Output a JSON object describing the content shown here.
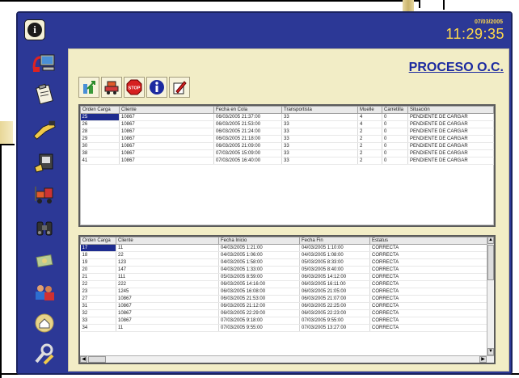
{
  "header": {
    "info_label": "i",
    "date": "07/03/2005",
    "clock": "11:29:35"
  },
  "page": {
    "title": "PROCESO O.C."
  },
  "toolbar": {
    "icons": [
      "green-arrow-icon",
      "truck-icon",
      "stop-icon",
      "info-icon",
      "edit-icon"
    ]
  },
  "sidebar": {
    "icons": [
      "computer-icon",
      "clipboard-icon",
      "scanner-icon",
      "printer-icon",
      "forklift-icon",
      "binoculars-icon",
      "money-icon",
      "users-icon",
      "home-icon",
      "tools-icon"
    ]
  },
  "top_grid": {
    "columns": [
      "Orden Carga",
      "Cliente",
      "Fecha en Cola",
      "Transportista",
      "Muelle",
      "Carretilla",
      "Situación"
    ],
    "rows": [
      [
        "25",
        "10867",
        "06/03/2005 21:37:00",
        "33",
        "4",
        "0",
        "PENDIENTE DE CARGAR"
      ],
      [
        "26",
        "10867",
        "06/03/2005 21:53:00",
        "33",
        "4",
        "0",
        "PENDIENTE DE CARGAR"
      ],
      [
        "28",
        "10867",
        "06/03/2005 21:24:00",
        "33",
        "2",
        "0",
        "PENDIENTE DE CARGAR"
      ],
      [
        "29",
        "10867",
        "06/03/2005 21:18:00",
        "33",
        "2",
        "0",
        "PENDIENTE DE CARGAR"
      ],
      [
        "30",
        "10867",
        "06/03/2005 21:09:00",
        "33",
        "2",
        "0",
        "PENDIENTE DE CARGAR"
      ],
      [
        "38",
        "10867",
        "07/03/2005 15:09:00",
        "33",
        "2",
        "0",
        "PENDIENTE DE CARGAR"
      ],
      [
        "41",
        "10867",
        "07/03/2005 16:40:00",
        "33",
        "2",
        "0",
        "PENDIENTE DE CARGAR"
      ]
    ]
  },
  "bottom_grid": {
    "columns": [
      "Orden Carga",
      "Cliente",
      "Fecha Inicio",
      "Fecha Fin",
      "Estatus"
    ],
    "rows": [
      [
        "17",
        "11",
        "04/03/2005 1:21:00",
        "04/03/2005 1:10:00",
        "CORRECTA"
      ],
      [
        "18",
        "22",
        "04/03/2005 1:06:00",
        "04/03/2005 1:08:00",
        "CORRECTA"
      ],
      [
        "19",
        "123",
        "04/03/2005 1:58:00",
        "05/03/2005 8:33:00",
        "CORRECTA"
      ],
      [
        "20",
        "147",
        "04/03/2005 1:33:00",
        "05/03/2005 8:40:00",
        "CORRECTA"
      ],
      [
        "21",
        "111",
        "05/03/2005 8:59:00",
        "06/03/2005 14:12:00",
        "CORRECTA"
      ],
      [
        "22",
        "222",
        "06/03/2005 14:16:00",
        "06/03/2005 16:11:00",
        "CORRECTA"
      ],
      [
        "23",
        "1245",
        "06/03/2005 16:08:00",
        "06/03/2005 21:05:00",
        "CORRECTA"
      ],
      [
        "27",
        "10867",
        "06/03/2005 21:53:00",
        "06/03/2005 21:07:00",
        "CORRECTA"
      ],
      [
        "31",
        "10867",
        "06/03/2005 21:12:00",
        "06/03/2005 22:25:00",
        "CORRECTA"
      ],
      [
        "32",
        "10867",
        "06/03/2005 22:29:00",
        "06/03/2005 22:23:00",
        "CORRECTA"
      ],
      [
        "33",
        "10867",
        "07/03/2005 9:18:00",
        "07/03/2005 9:55:00",
        "CORRECTA"
      ],
      [
        "34",
        "11",
        "07/03/2005 9:55:00",
        "07/03/2005 13:27:00",
        "CORRECTA"
      ]
    ]
  },
  "colors": {
    "frame": "#2c3896",
    "content_bg": "#f2edc6",
    "title": "#1c2aa0",
    "clock": "#ffd94a"
  }
}
